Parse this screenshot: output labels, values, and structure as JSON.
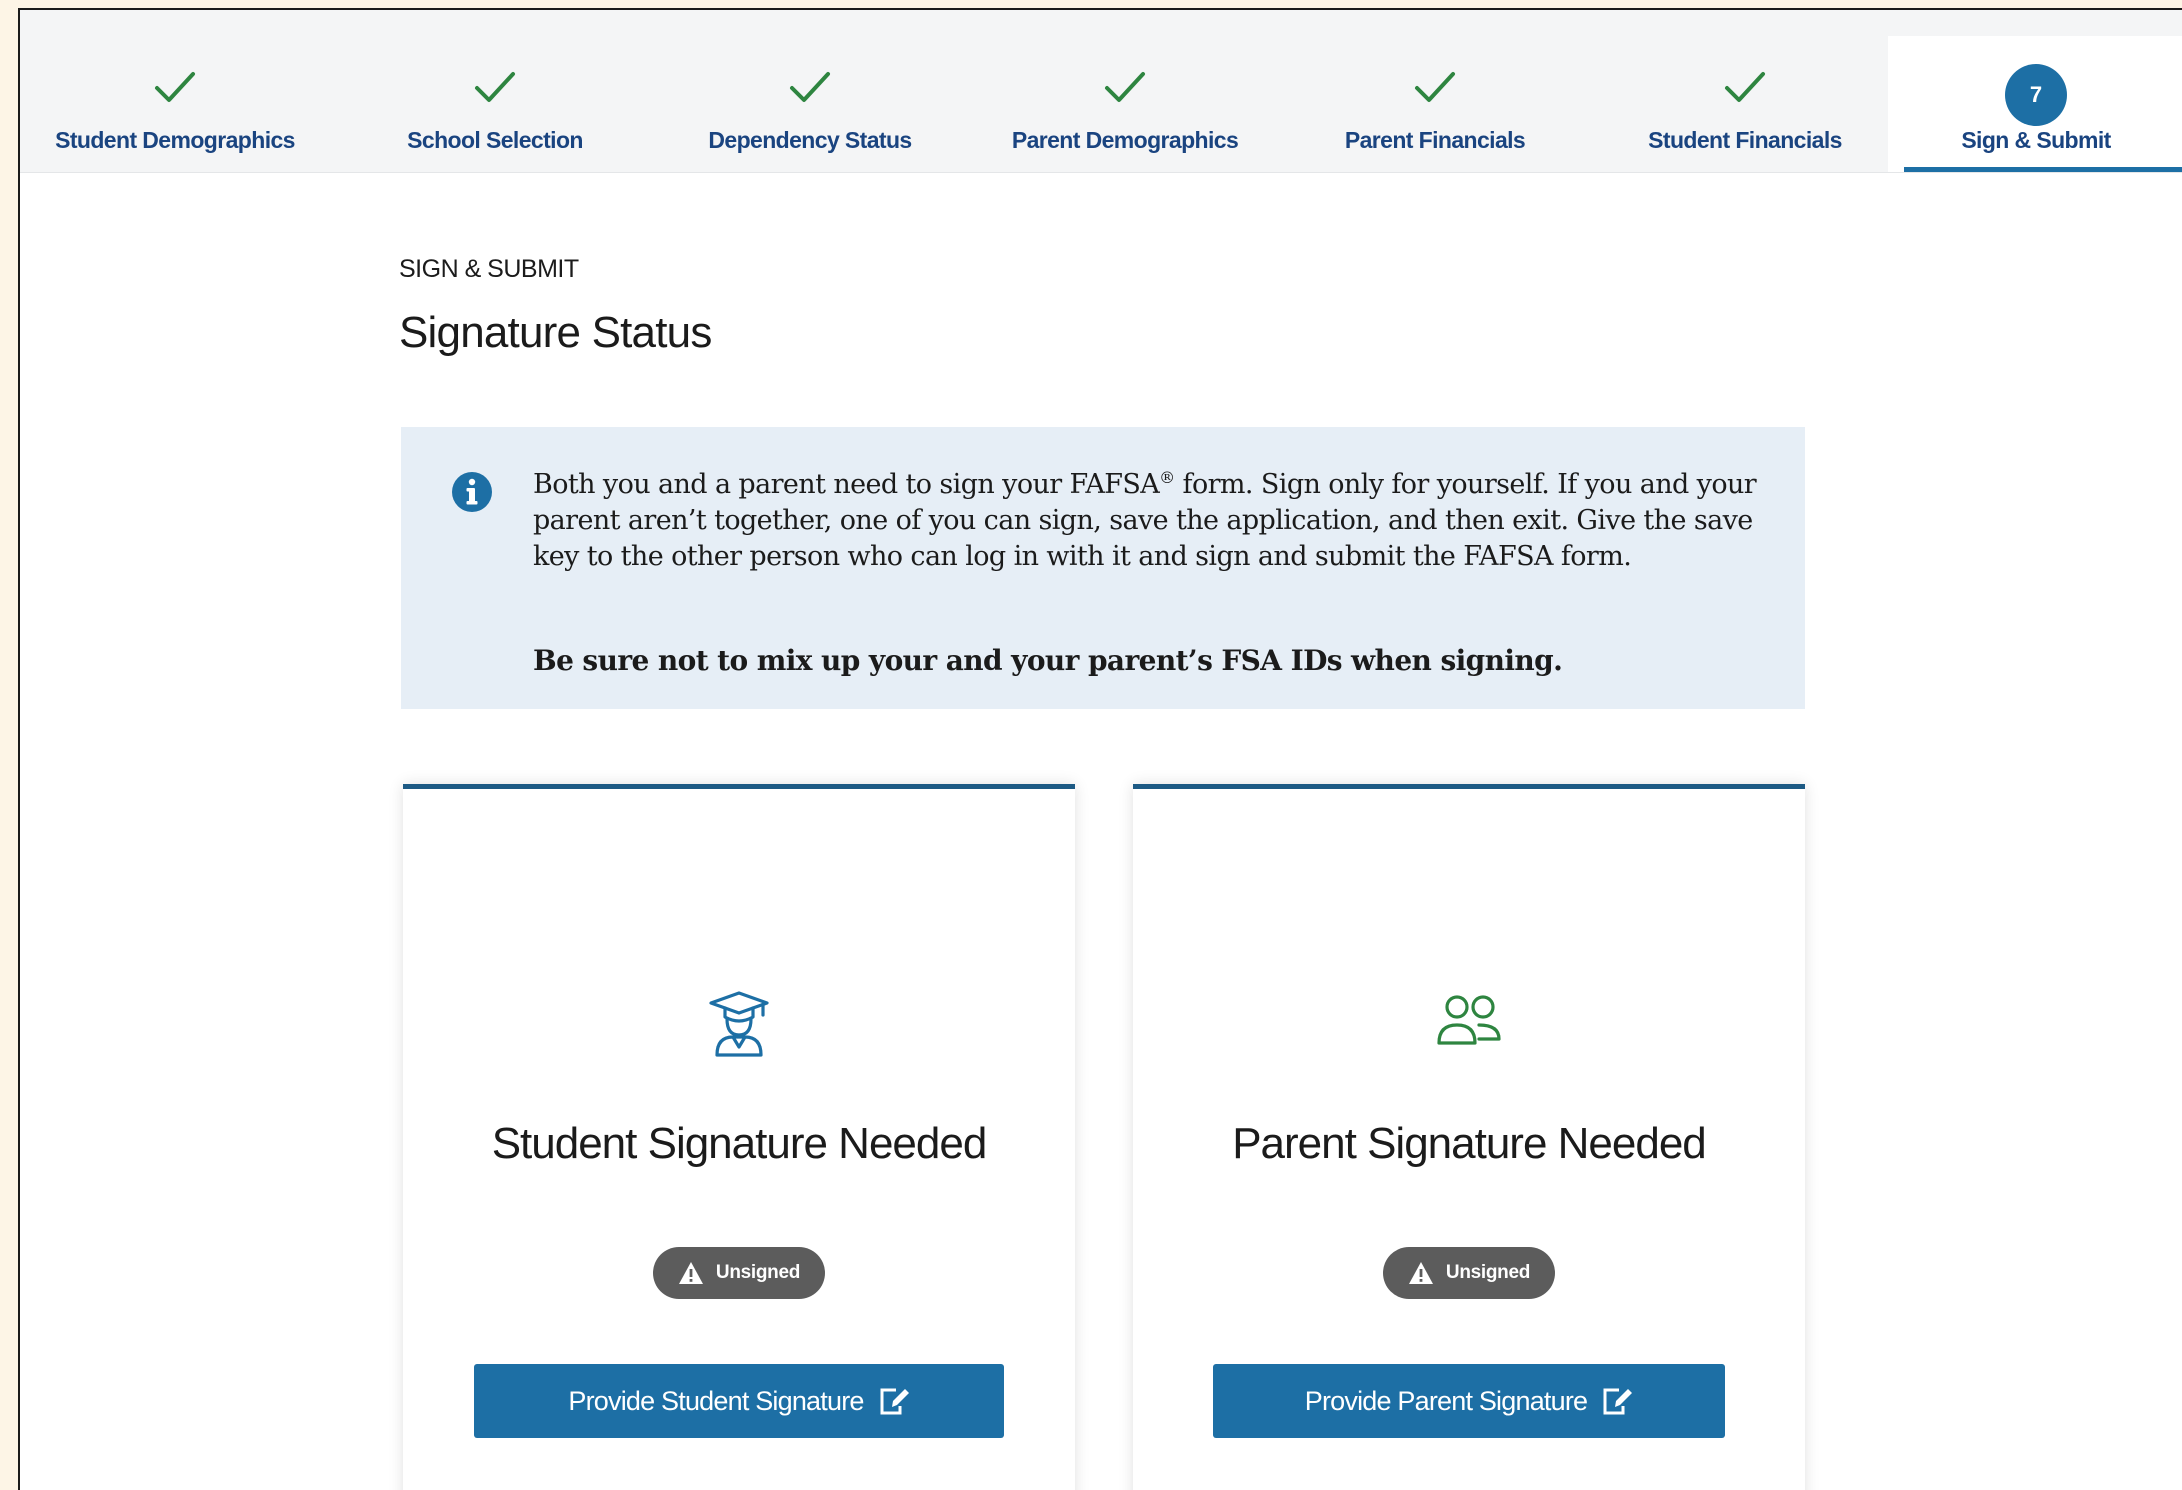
{
  "stepper": {
    "steps": [
      {
        "label": "Student Demographics",
        "status": "complete"
      },
      {
        "label": "School Selection",
        "status": "complete"
      },
      {
        "label": "Dependency Status",
        "status": "complete"
      },
      {
        "label": "Parent Demographics",
        "status": "complete"
      },
      {
        "label": "Parent Financials",
        "status": "complete"
      },
      {
        "label": "Student Financials",
        "status": "complete"
      },
      {
        "label": "Sign & Submit",
        "status": "current",
        "number": "7"
      }
    ]
  },
  "page": {
    "eyebrow": "SIGN & SUBMIT",
    "title": "Signature Status"
  },
  "info": {
    "text_before_mark": "Both you and a parent need to sign your FAFSA",
    "mark": "®",
    "text_after_mark": " form. Sign only for yourself. If you and your parent aren’t together, one of you can sign, save the application, and then exit. Give the save key to the other person who can log in with it and sign and submit the FAFSA form.",
    "bold_text": "Be sure not to mix up your and your parent’s FSA IDs when signing."
  },
  "cards": {
    "student": {
      "icon": "student-graduate-icon",
      "title": "Student Signature Needed",
      "badge": "Unsigned",
      "button": "Provide Student Signature"
    },
    "parent": {
      "icon": "parents-icon",
      "title": "Parent Signature Needed",
      "badge": "Unsigned",
      "button": "Provide Parent Signature"
    }
  },
  "colors": {
    "check": "#2e8540",
    "step_label": "#1a4480",
    "primary": "#1d6fa5",
    "badge_bg": "#5c5c5c",
    "info_bg": "#e6eef6",
    "student_icon": "#1d6fa5",
    "parent_icon": "#2e8540"
  }
}
